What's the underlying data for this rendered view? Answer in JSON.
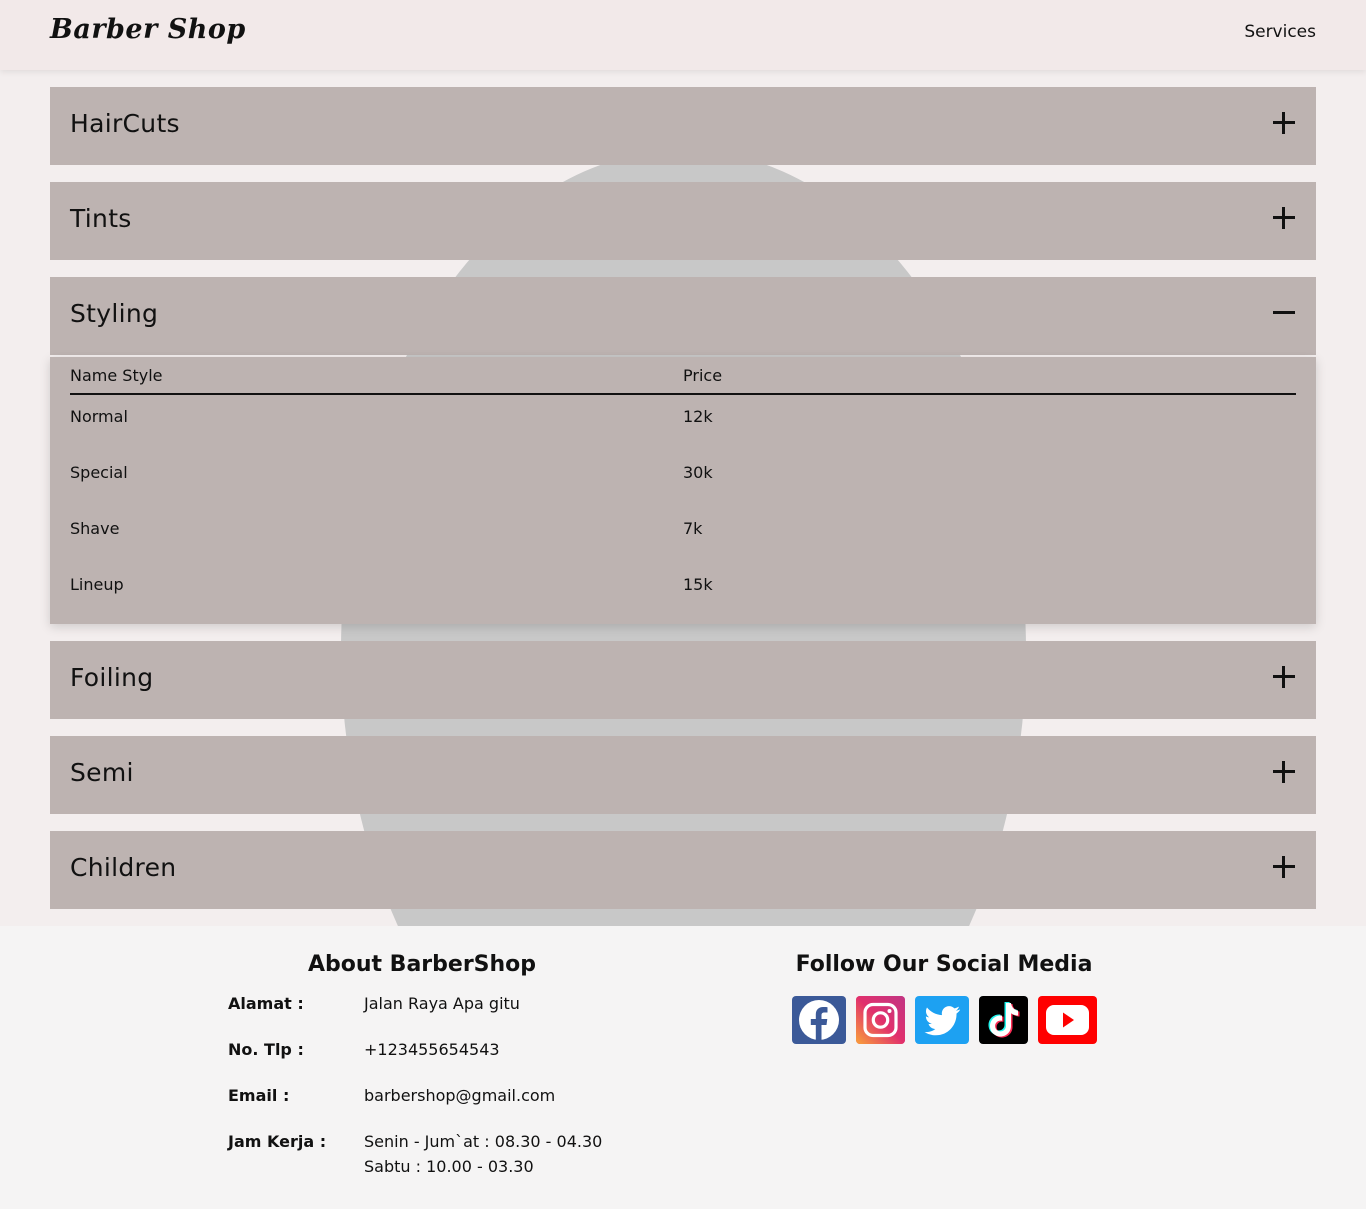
{
  "navbar": {
    "brand": "Barber Shop",
    "link": "Services"
  },
  "accordion": {
    "items": [
      {
        "title": "HairCuts",
        "expanded": false
      },
      {
        "title": "Tints",
        "expanded": false
      },
      {
        "title": "Styling",
        "expanded": true
      },
      {
        "title": "Foiling",
        "expanded": false
      },
      {
        "title": "Semi",
        "expanded": false
      },
      {
        "title": "Children",
        "expanded": false
      }
    ],
    "styling_table": {
      "headers": [
        "Name Style",
        "Price"
      ],
      "rows": [
        [
          "Normal",
          "12k"
        ],
        [
          "Special",
          "30k"
        ],
        [
          "Shave",
          "7k"
        ],
        [
          "Lineup",
          "15k"
        ]
      ]
    }
  },
  "footer": {
    "about_title": "About BarberShop",
    "info": [
      {
        "label": "Alamat :",
        "value": "Jalan Raya Apa gitu"
      },
      {
        "label": "No. Tlp :",
        "value": "+123455654543"
      },
      {
        "label": "Email :",
        "value": "barbershop@gmail.com"
      },
      {
        "label": "Jam Kerja :",
        "value": "Senin - Jum`at : 08.30 - 04.30",
        "value2": "Sabtu : 10.00 - 03.30"
      }
    ],
    "social_title": "Follow Our Social Media",
    "social": [
      {
        "icon": "facebook-icon",
        "color": "#3b5998"
      },
      {
        "icon": "instagram-icon",
        "color": "#e1306c"
      },
      {
        "icon": "twitter-icon",
        "color": "#1da1f2"
      },
      {
        "icon": "tiktok-icon",
        "color": "#000000"
      },
      {
        "icon": "youtube-icon",
        "color": "#ff0000"
      }
    ]
  },
  "colors": {
    "panel": "#bdb3b1",
    "background": "#f3eeee",
    "navbar": "#f2e9e9",
    "footer": "#f5f4f4"
  }
}
